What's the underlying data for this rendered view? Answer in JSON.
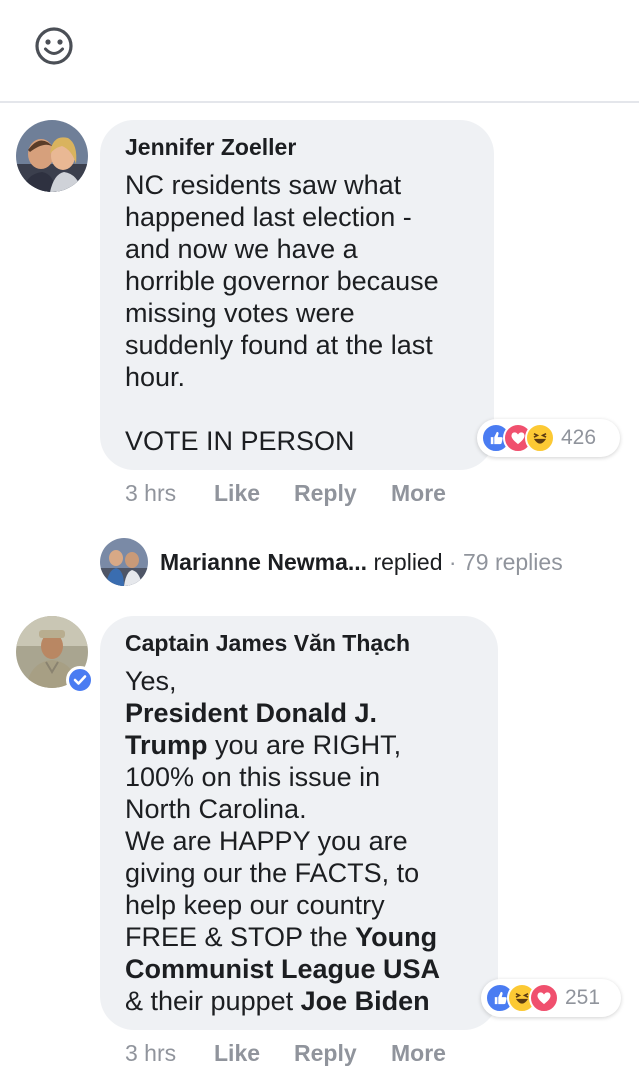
{
  "comments": [
    {
      "author": "Jennifer Zoeller",
      "body_lines": [
        "NC residents saw what",
        "happened last election -",
        "and now we have a",
        "horrible governor because",
        "missing votes were",
        "suddenly found at the last",
        "hour.",
        "",
        "VOTE IN PERSON"
      ],
      "reaction_count": "426",
      "reaction_icons": [
        "like-icon",
        "love-icon",
        "haha-icon"
      ],
      "time": "3 hrs",
      "like_label": "Like",
      "reply_label": "Reply",
      "more_label": "More"
    },
    {
      "author": "Captain James Văn Thạch",
      "body": {
        "l1": "Yes,",
        "l2_bold": "President Donald J.",
        "l3_bold": "Trump",
        "l3_rest": " you are RIGHT,",
        "l4": "100% on this issue in",
        "l5": "North Carolina.",
        "l6": "We are HAPPY you are",
        "l7": "giving our the FACTS, to",
        "l8": "help keep our country",
        "l9_pre": "FREE & STOP the ",
        "l9_bold": "Young",
        "l10_bold": "Communist League USA",
        "l11_pre": "& their puppet ",
        "l11_bold": "Joe Biden"
      },
      "reaction_count": "251",
      "reaction_icons": [
        "like-icon",
        "haha-icon",
        "love-icon"
      ],
      "time": "3 hrs",
      "like_label": "Like",
      "reply_label": "Reply",
      "more_label": "More"
    }
  ],
  "replies_summary": {
    "name": "Marianne Newma...",
    "action": " replied",
    "separator": " · ",
    "count": "79 replies"
  },
  "colors": {
    "bubble": "#eff1f4",
    "meta_text": "#90949c",
    "like_blue": "#4a7cf2",
    "love_red": "#f0506e",
    "haha_yellow": "#fcc934"
  }
}
